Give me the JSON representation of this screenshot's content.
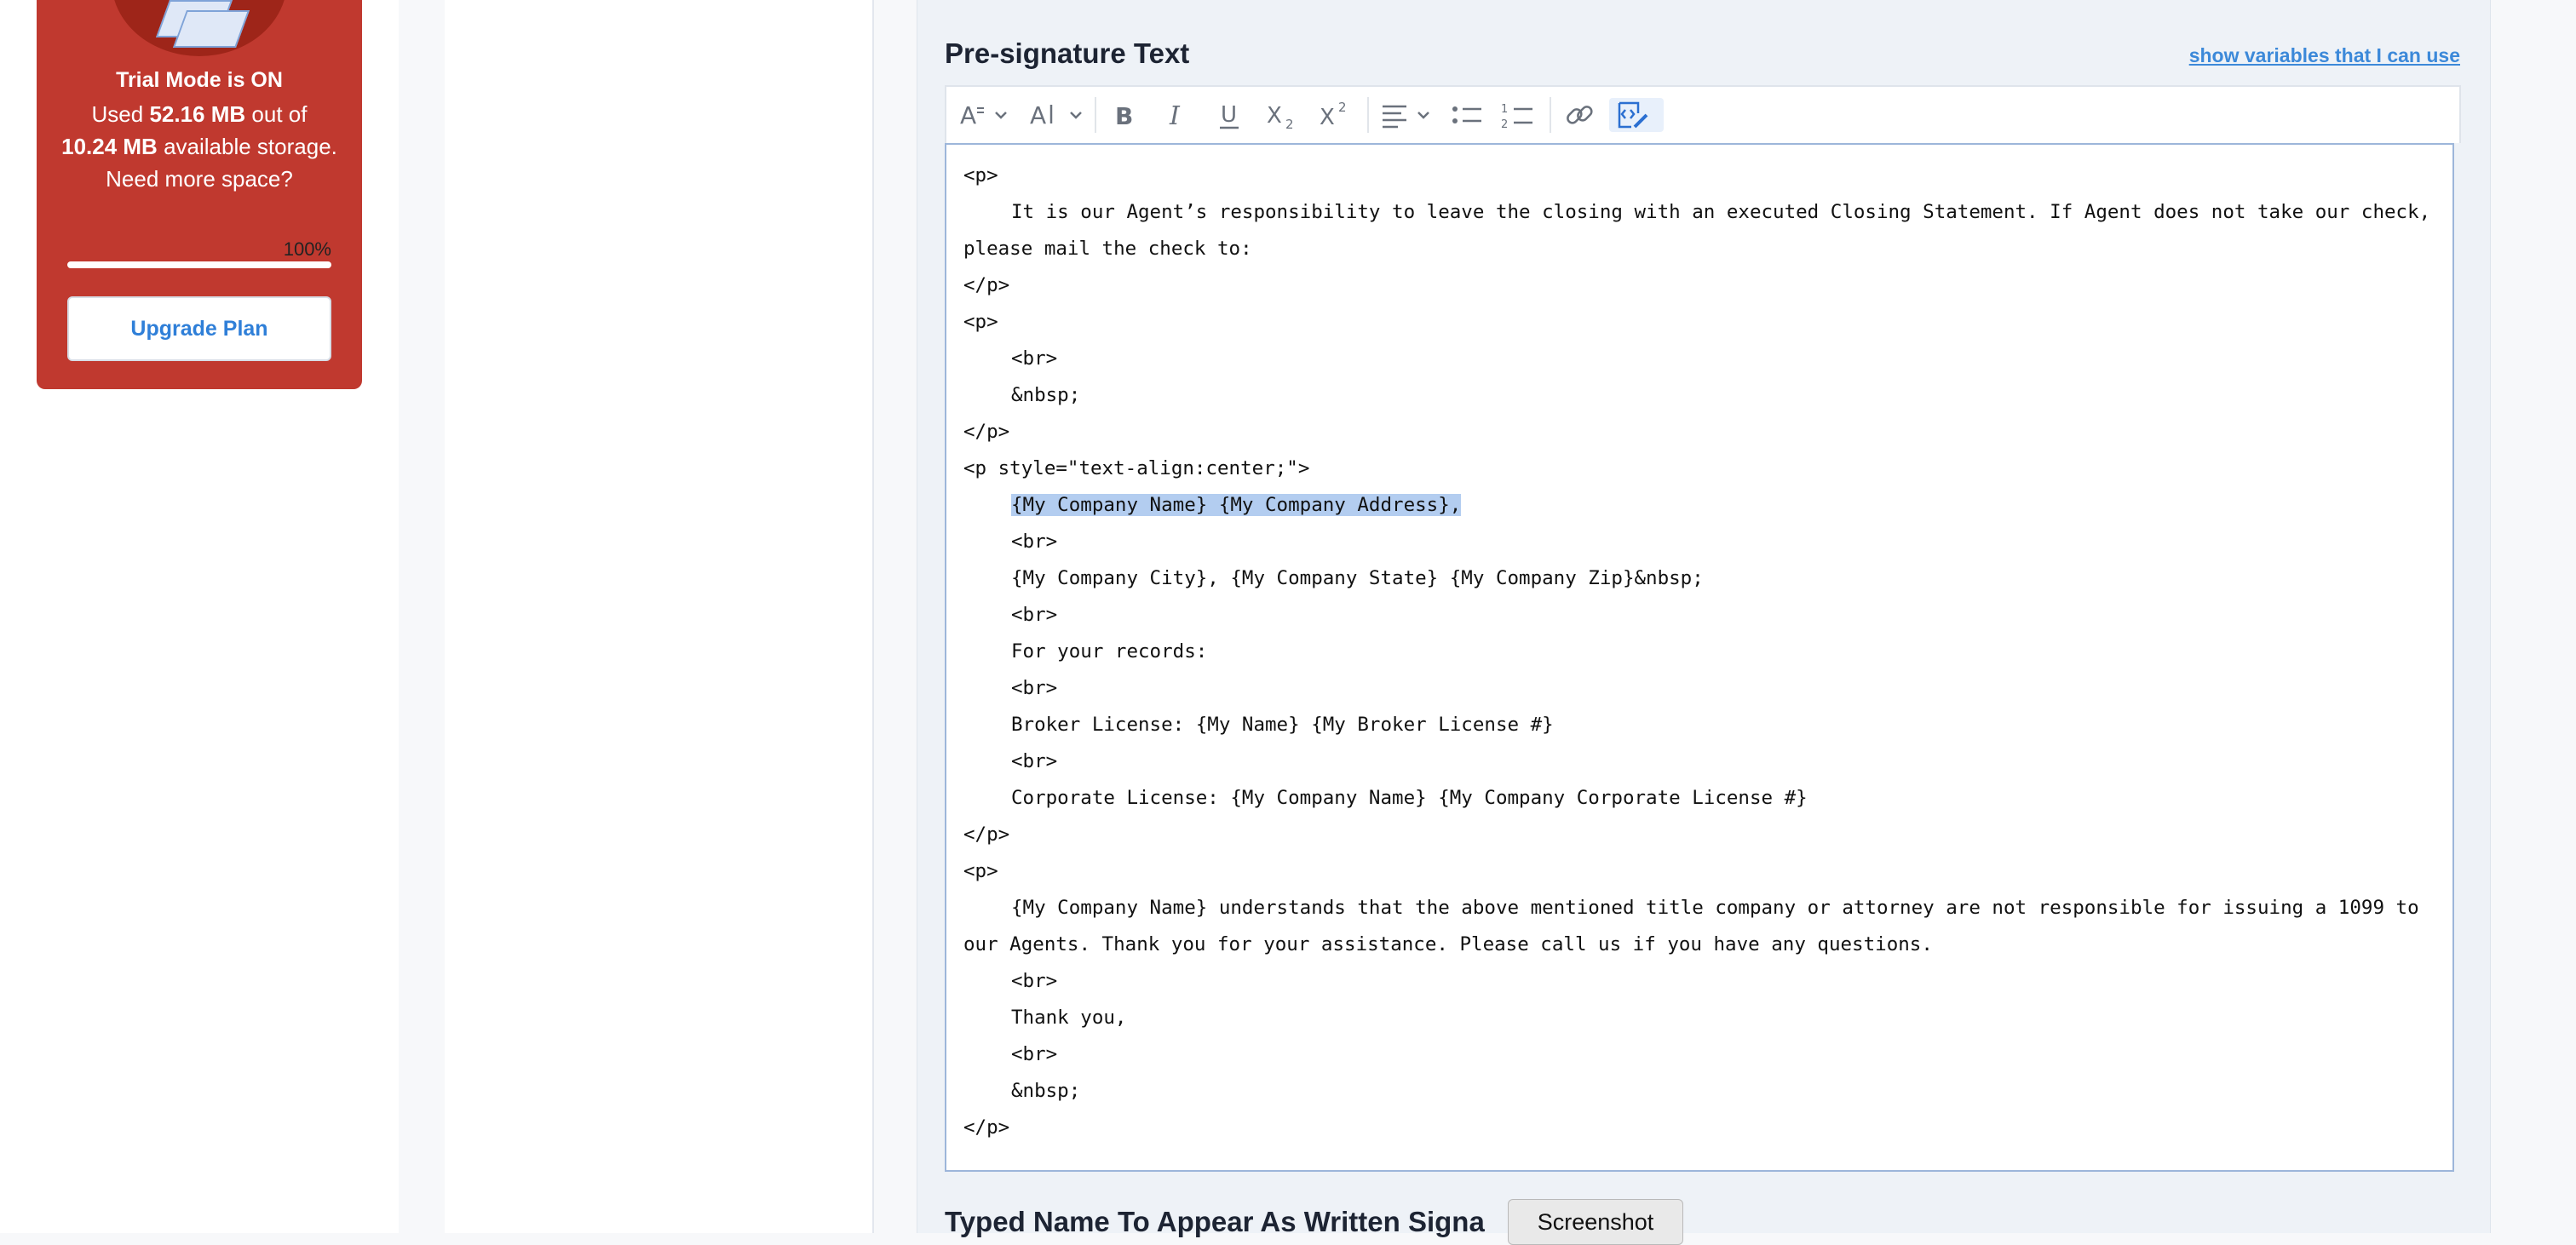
{
  "sidebar": {
    "trial_title": "Trial Mode is ON",
    "usage_prefix": "Used",
    "used_amount": "52.16 MB",
    "usage_mid": "out of",
    "total_amount": "10.24 MB",
    "usage_suffix": "available storage.",
    "need_more": "Need more space?",
    "progress_label": "100%",
    "progress_value": 1.0,
    "upgrade_label": "Upgrade Plan",
    "card_color": "#c0392f"
  },
  "section": {
    "title": "Pre-signature Text",
    "variables_link": "show variables that I can use"
  },
  "toolbar": {
    "buttons": [
      {
        "name": "font-family-dropdown",
        "icon": "font-family-icon"
      },
      {
        "name": "font-size-dropdown",
        "icon": "font-size-icon"
      },
      {
        "name": "bold-button",
        "icon": "bold-icon"
      },
      {
        "name": "italic-button",
        "icon": "italic-icon"
      },
      {
        "name": "underline-button",
        "icon": "underline-icon"
      },
      {
        "name": "subscript-button",
        "icon": "subscript-icon"
      },
      {
        "name": "superscript-button",
        "icon": "superscript-icon"
      },
      {
        "name": "align-dropdown",
        "icon": "align-left-icon"
      },
      {
        "name": "bulleted-list-button",
        "icon": "bulleted-list-icon"
      },
      {
        "name": "numbered-list-button",
        "icon": "numbered-list-icon"
      },
      {
        "name": "link-button",
        "icon": "link-icon"
      },
      {
        "name": "source-editing-button",
        "icon": "source-code-icon",
        "active": true
      }
    ]
  },
  "editor": {
    "lines": [
      {
        "text": "<p>",
        "indent": false
      },
      {
        "text": "It is our Agent’s responsibility to leave the closing with an executed Closing Statement. If Agent does not take our check, please mail the check to:",
        "indent": true,
        "wrap": true
      },
      {
        "text": "</p>",
        "indent": false
      },
      {
        "text": "<p>",
        "indent": false
      },
      {
        "text": "<br>",
        "indent": true
      },
      {
        "text": "&nbsp;",
        "indent": true
      },
      {
        "text": "</p>",
        "indent": false
      },
      {
        "text": "<p style=\"text-align:center;\">",
        "indent": false
      },
      {
        "text": "{My Company Name} {My Company Address},",
        "indent": true,
        "highlight": true
      },
      {
        "text": "<br>",
        "indent": true
      },
      {
        "text": "{My Company City}, {My Company State} {My Company Zip}&nbsp;",
        "indent": true
      },
      {
        "text": "<br>",
        "indent": true
      },
      {
        "text": "For your records:",
        "indent": true
      },
      {
        "text": "<br>",
        "indent": true
      },
      {
        "text": "Broker License: {My Name} {My Broker License #}",
        "indent": true
      },
      {
        "text": "<br>",
        "indent": true
      },
      {
        "text": "Corporate License: {My Company Name} {My Company Corporate License #}",
        "indent": true
      },
      {
        "text": "</p>",
        "indent": false
      },
      {
        "text": "<p>",
        "indent": false
      },
      {
        "text": "{My Company Name} understands that the above mentioned title company or attorney are not responsible for issuing a 1099 to our Agents. Thank you for your assistance. Please call us if you have any questions.",
        "indent": true,
        "wrap": true
      },
      {
        "text": "<br>",
        "indent": true
      },
      {
        "text": "Thank you,",
        "indent": true
      },
      {
        "text": "<br>",
        "indent": true
      },
      {
        "text": "&nbsp;",
        "indent": true
      },
      {
        "text": "</p>",
        "indent": false
      }
    ]
  },
  "next_section": {
    "title": "Typed Name To Appear As Written Signa"
  },
  "tooltip": {
    "label": "Screenshot"
  }
}
